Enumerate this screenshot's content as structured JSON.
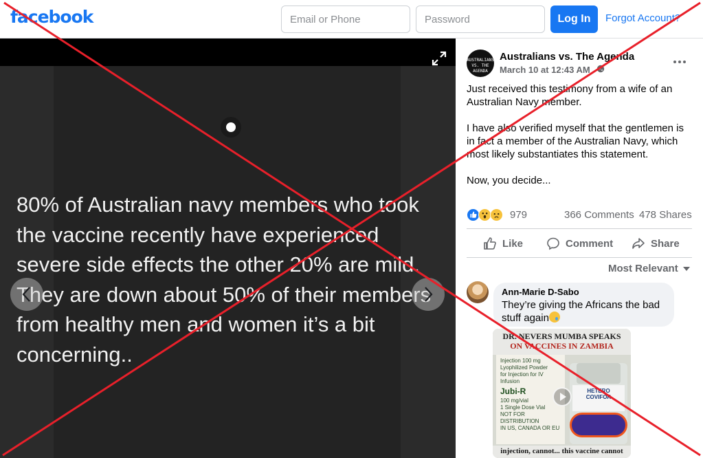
{
  "header": {
    "logo": "facebook",
    "email_placeholder": "Email or Phone",
    "password_placeholder": "Password",
    "login_label": "Log In",
    "forgot_label": "Forgot Account?"
  },
  "media": {
    "text": "80% of Australian navy members who took the vaccine recently have experienced severe side effects the other 20% are mild. They are down about 50% of their members from healthy men and women it’s a bit concerning..",
    "icons": [
      "expand-icon",
      "chevron-left-icon",
      "chevron-right-icon"
    ]
  },
  "post": {
    "avatar_text": "AUSTRALIANS VS. THE AGENDA",
    "page_name": "Australians vs. The Agenda",
    "date": "March 10 at 12:43 AM",
    "paragraphs": [
      "Just received this testimony from a wife of an Australian Navy member.",
      "I have also verified myself that the gentlemen is in fact a member of the Australian Navy, which most likely substantiates this statement.",
      "Now, you decide..."
    ],
    "reaction_count": "979",
    "comments_count": "366 Comments",
    "shares_count": "478 Shares",
    "actions": {
      "like": "Like",
      "comment": "Comment",
      "share": "Share"
    },
    "sort_label": "Most Relevant"
  },
  "comment": {
    "author": "Ann-Marie D-Sabo",
    "text": "They’re giving the Africans the bad stuff again",
    "video": {
      "title_line1": "DR. NEVERS MUMBA SPEAKS",
      "title_line2": "ON VACCINES IN ZAMBIA",
      "vial_left_lines": [
        "Injection 100 mg",
        "Lyophilized Powder",
        "for Injection for IV Infusion",
        "Jubi-R",
        "100 mg/vial",
        "1 Single Dose Vial",
        "NOT FOR DISTRIBUTION",
        "IN US, CANADA OR EU"
      ],
      "vial_right_brand": "HETERO",
      "vial_right_name": "COVIFOR",
      "caption": "injection, cannot... this vaccine cannot"
    }
  },
  "colors": {
    "brand_blue": "#1877f2",
    "overlay_red": "#e8202a",
    "viewer_bg": "#000000"
  }
}
